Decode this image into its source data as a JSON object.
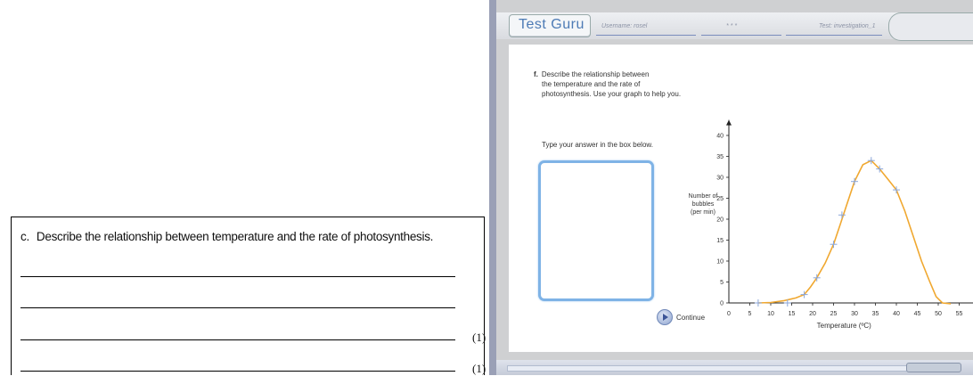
{
  "worksheet": {
    "question_number": "c.",
    "question_text": "Describe the relationship between temperature and the rate of photosynthesis.",
    "marks": [
      "(1)",
      "(1)"
    ]
  },
  "app": {
    "logo": "Test Guru",
    "username_label": "Username: rosel",
    "dots": "* * *",
    "test_label": "Test: investigation_1",
    "question_label": "f.",
    "question_lines": [
      "Describe the relationship between",
      "the temperature and the rate of",
      "photosynthesis. Use your graph to help you."
    ],
    "instruction": "Type your answer in the box below.",
    "continue_label": "Continue"
  },
  "colors": {
    "curve": "#f0a830",
    "answer_border": "#7fb3e6",
    "point": "#8aa6d8"
  },
  "chart_data": {
    "type": "line",
    "title": "",
    "xlabel": "Temperature (ºC)",
    "ylabel_lines": [
      "Number of",
      "bubbles",
      "(per min)"
    ],
    "x_ticks": [
      0,
      5,
      10,
      15,
      20,
      25,
      30,
      35,
      40,
      45,
      50,
      55
    ],
    "y_ticks": [
      0,
      5,
      10,
      15,
      20,
      25,
      30,
      35,
      40
    ],
    "xlim": [
      0,
      57
    ],
    "ylim": [
      0,
      42
    ],
    "grid": false,
    "points": [
      {
        "x": 7,
        "y": 0
      },
      {
        "x": 14,
        "y": 0
      },
      {
        "x": 18,
        "y": 2
      },
      {
        "x": 21,
        "y": 6
      },
      {
        "x": 25,
        "y": 14
      },
      {
        "x": 27,
        "y": 21
      },
      {
        "x": 30,
        "y": 29
      },
      {
        "x": 34,
        "y": 34
      },
      {
        "x": 36,
        "y": 32
      },
      {
        "x": 40,
        "y": 27
      }
    ],
    "curve": [
      [
        7,
        0
      ],
      [
        10,
        0.1
      ],
      [
        13,
        0.5
      ],
      [
        16,
        1.2
      ],
      [
        18,
        2
      ],
      [
        19.5,
        3.8
      ],
      [
        21,
        6
      ],
      [
        23,
        9.5
      ],
      [
        25,
        14
      ],
      [
        26.5,
        18.5
      ],
      [
        28,
        23
      ],
      [
        30,
        29
      ],
      [
        32,
        33
      ],
      [
        34,
        34
      ],
      [
        36,
        32
      ],
      [
        38,
        29.5
      ],
      [
        40,
        27
      ],
      [
        42,
        22
      ],
      [
        44,
        16
      ],
      [
        46,
        10
      ],
      [
        48,
        5
      ],
      [
        49.5,
        1.5
      ],
      [
        51,
        0
      ],
      [
        53,
        -0.2
      ]
    ]
  }
}
